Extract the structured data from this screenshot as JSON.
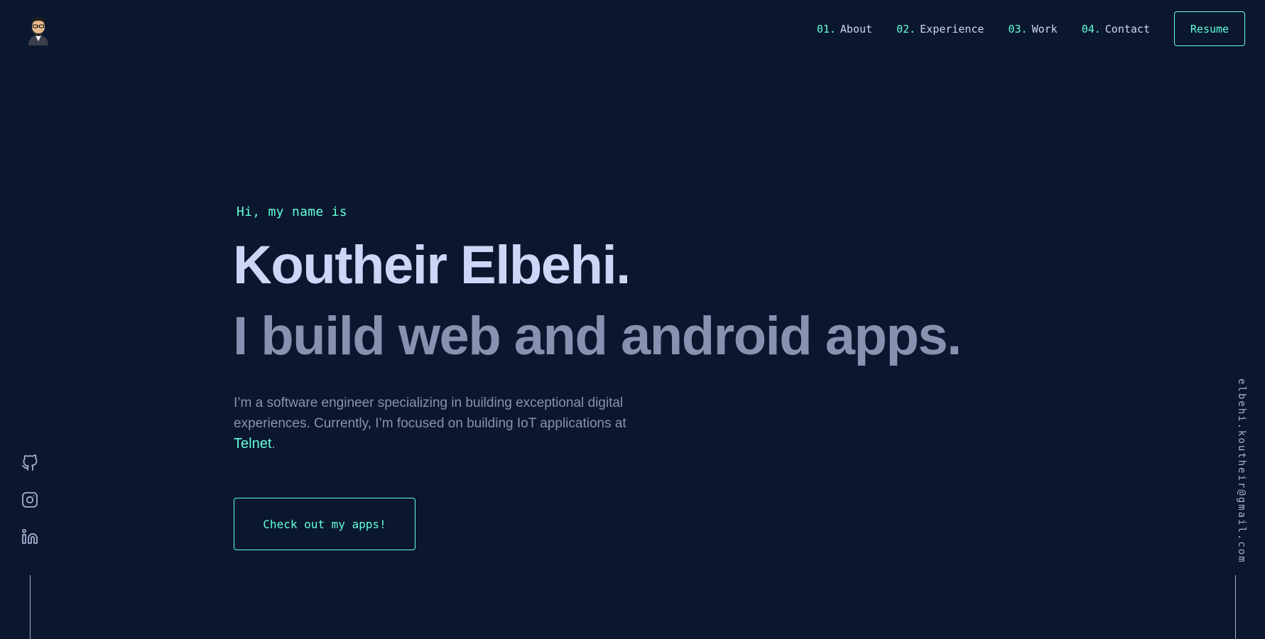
{
  "nav": {
    "items": [
      {
        "num": "01.",
        "label": "About"
      },
      {
        "num": "02.",
        "label": "Experience"
      },
      {
        "num": "03.",
        "label": "Work"
      },
      {
        "num": "04.",
        "label": "Contact"
      }
    ],
    "resume_label": "Resume"
  },
  "hero": {
    "greeting": "Hi, my name is",
    "name": "Koutheir Elbehi.",
    "tagline": "I build web and android apps.",
    "intro": "I’m a software engineer specializing in building exceptional digital experiences. Currently, I’m focused on building IoT applications at ",
    "company": "Telnet",
    "intro_end": ".",
    "cta_label": "Check out my apps!"
  },
  "sidebar": {
    "email": "elbehi.koutheir@gmail.com",
    "socials": [
      "github-icon",
      "instagram-icon",
      "linkedin-icon"
    ]
  },
  "colors": {
    "background": "#0b172f",
    "accent": "#64ffda",
    "heading": "#ccd6f6",
    "text": "#8892b0"
  }
}
